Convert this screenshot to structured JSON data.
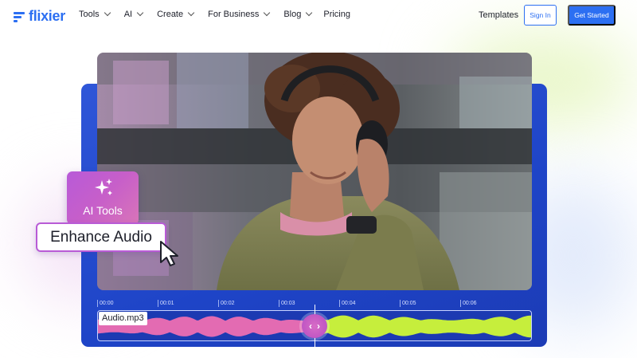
{
  "brand": {
    "name": "flixier",
    "color": "#2c6ff2"
  },
  "nav": {
    "items": [
      {
        "label": "Tools",
        "has_dropdown": true
      },
      {
        "label": "AI",
        "has_dropdown": true
      },
      {
        "label": "Create",
        "has_dropdown": true
      },
      {
        "label": "For Business",
        "has_dropdown": true
      },
      {
        "label": "Blog",
        "has_dropdown": true
      },
      {
        "label": "Pricing",
        "has_dropdown": false
      }
    ],
    "templates": "Templates",
    "sign_in": "Sign In",
    "get_started": "Get Started"
  },
  "hero": {
    "ai_card_label": "AI Tools",
    "ai_card_icon": "sparkles-icon",
    "enhance_label": "Enhance Audio",
    "timeline": {
      "ticks": [
        "00:00",
        "00:01",
        "00:02",
        "00:03",
        "00:04",
        "00:05",
        "00:06"
      ],
      "audio_file": "Audio.mp3",
      "wave_colors": {
        "processed": "#e36bb2",
        "original": "#c6ee3c"
      }
    }
  }
}
